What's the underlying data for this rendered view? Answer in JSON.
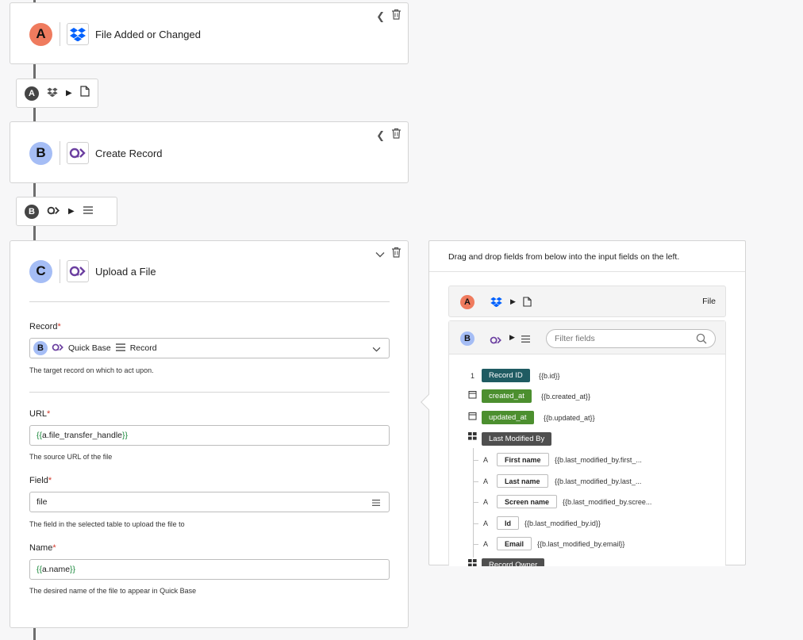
{
  "steps": [
    {
      "letter": "A",
      "title": "File Added or Changed"
    },
    {
      "letter": "B",
      "title": "Create Record"
    },
    {
      "letter": "C",
      "title": "Upload a File"
    }
  ],
  "pills": [
    {
      "letter": "A"
    },
    {
      "letter": "B"
    }
  ],
  "form": {
    "record": {
      "label": "Record",
      "badge": "B",
      "app": "Quick Base",
      "entity": "Record",
      "help": "The target record on which to act upon."
    },
    "url": {
      "label": "URL",
      "value_pre": "{{",
      "value": "a.file_transfer_handle",
      "value_post": "}}",
      "help": "The source URL of the file"
    },
    "field": {
      "label": "Field",
      "value": "file",
      "help": "The field in the selected table to upload the file to"
    },
    "name": {
      "label": "Name",
      "value_pre": "{{",
      "value": "a.name",
      "value_post": "}}",
      "help": "The desired name of the file to appear in Quick Base"
    },
    "required_mark": "*"
  },
  "panel": {
    "header": "Drag and drop fields from below into the input fields on the left.",
    "source_a": {
      "letter": "A",
      "label": "File"
    },
    "source_b": {
      "letter": "B",
      "filter_placeholder": "Filter fields"
    },
    "fields": [
      {
        "type_glyph": "1",
        "name": "Record ID",
        "path": "{{b.id}}"
      },
      {
        "type_glyph": "▭",
        "name": "created_at",
        "path": "{{b.created_at}}"
      },
      {
        "type_glyph": "▭",
        "name": "updated_at",
        "path": "{{b.updated_at}}"
      },
      {
        "type_glyph": "▦",
        "name": "Last Modified By",
        "path": ""
      }
    ],
    "subfields": [
      {
        "type_glyph": "A",
        "name": "First name",
        "path": "{{b.last_modified_by.first_..."
      },
      {
        "type_glyph": "A",
        "name": "Last name",
        "path": "{{b.last_modified_by.last_..."
      },
      {
        "type_glyph": "A",
        "name": "Screen name",
        "path": "{{b.last_modified_by.scree..."
      },
      {
        "type_glyph": "A",
        "name": "Id",
        "path": "{{b.last_modified_by.id}}"
      },
      {
        "type_glyph": "A",
        "name": "Email",
        "path": "{{b.last_modified_by.email}}"
      }
    ],
    "next_group": {
      "type_glyph": "▦",
      "name": "Record Owner"
    }
  },
  "colors": {
    "step_a": "#ef7b5e",
    "step_b": "#a5bdf5",
    "required": "#d2392b",
    "tag_teal": "#1f5b62",
    "tag_green": "#4c8f2f",
    "tag_gray": "#4f4f4f"
  }
}
